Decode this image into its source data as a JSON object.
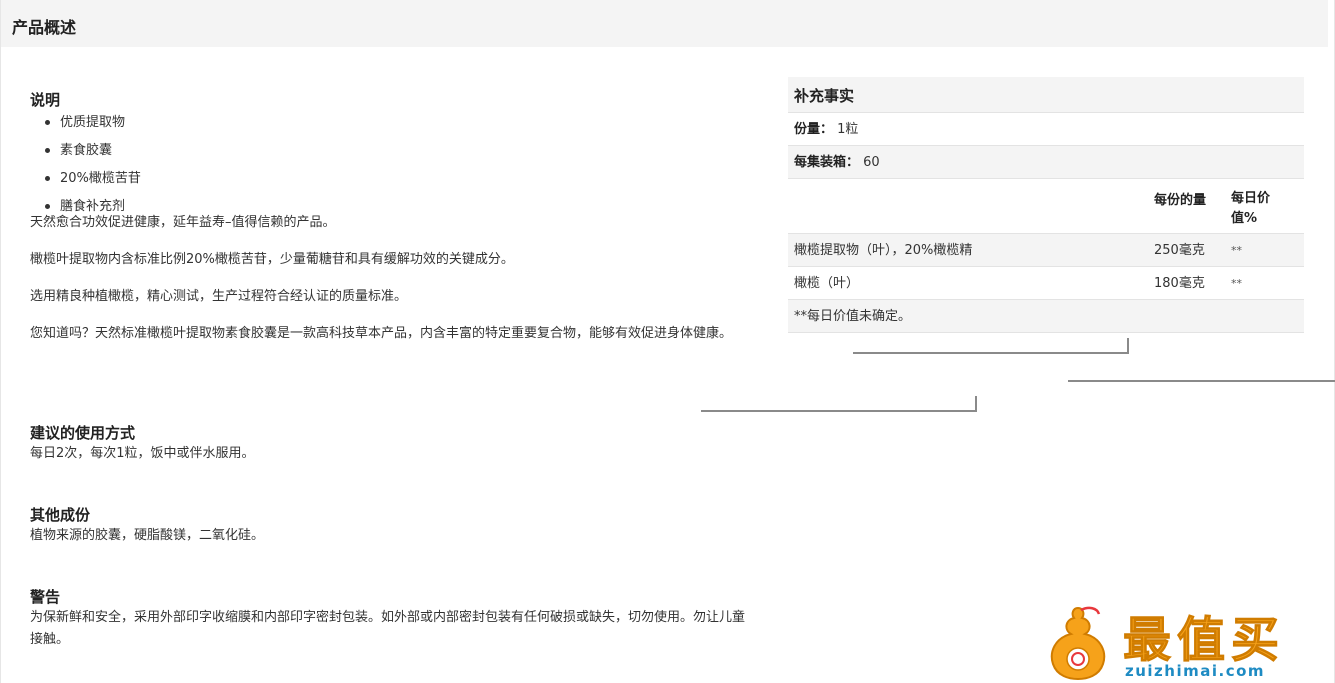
{
  "header": {
    "title": "产品概述"
  },
  "description": {
    "heading": "说明",
    "bullets": [
      "优质提取物",
      "素食胶囊",
      "20%橄榄苦苷",
      "膳食补充剂"
    ],
    "paragraphs": [
      "天然愈合功效促进健康，延年益寿–值得信赖的产品。",
      "橄榄叶提取物内含标准比例20%橄榄苦苷，少量葡糖苷和具有缓解功效的关键成分。",
      "选用精良种植橄榄，精心测试，生产过程符合经认证的质量标准。",
      "您知道吗？天然标准橄榄叶提取物素食胶囊是一款高科技草本产品，内含丰富的特定重要复合物，能够有效促进身体健康。"
    ]
  },
  "usage": {
    "heading": "建议的使用方式",
    "text": "每日2次，每次1粒，饭中或伴水服用。"
  },
  "other": {
    "heading": "其他成份",
    "text": "植物来源的胶囊，硬脂酸镁，二氧化硅。"
  },
  "warning": {
    "heading": "警告",
    "text": "为保新鲜和安全，采用外部印字收缩膜和内部印字密封包装。如外部或内部密封包装有任何破损或缺失，切勿使用。勿让儿童接触。"
  },
  "facts": {
    "title": "补充事实",
    "serving_label": "份量：",
    "serving_value": "1粒",
    "servings_label": "每集装箱：",
    "servings_value": "60",
    "col_amount": "每份的量",
    "col_daily": "每日价值%",
    "ingredients": [
      {
        "name": "橄榄提取物（叶），20%橄榄精",
        "amount": "250毫克",
        "dv": "**"
      },
      {
        "name": "橄榄（叶）",
        "amount": "180毫克",
        "dv": "**"
      }
    ],
    "note": "**每日价值未确定。"
  },
  "logo": {
    "text": "最值买",
    "url": "zuizhimai.com"
  },
  "colors": {
    "header_bg": "#f4f4f4",
    "logo_orange": "#f6a21a",
    "logo_blue": "#1e8bc3"
  }
}
